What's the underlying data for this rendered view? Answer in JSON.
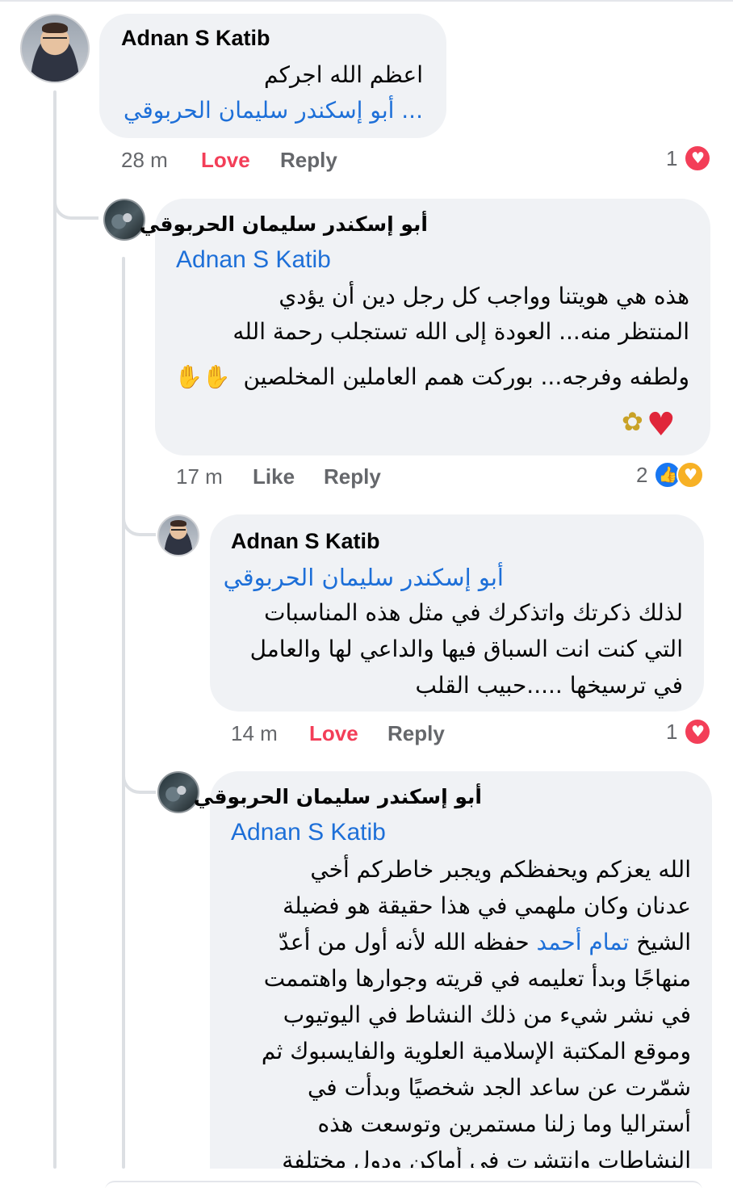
{
  "comments": [
    {
      "author": "Adnan S Katib",
      "line1": "اعظم الله اجركم",
      "line2_link": "... أبو إسكندر سليمان الحربوقي",
      "time": "28 m",
      "action": "Love",
      "reply": "Reply",
      "reaction_count": "1",
      "reactions": [
        "love"
      ]
    },
    {
      "author": "أبو إسكندر سليمان الحربوقي",
      "tag": "Adnan S Katib",
      "lines": [
        "هذه هي هويتنا وواجب كل رجل دين أن يؤدي",
        "المنتظر منه...  العودة إلى الله تستجلب رحمة الله",
        "ولطفه وفرجه... بوركت همم العاملين المخلصين"
      ],
      "inline_emoji": "hands-icon",
      "trailing_emojis": [
        "heart",
        "bouquet"
      ],
      "time": "17 m",
      "action": "Like",
      "reply": "Reply",
      "reaction_count": "2",
      "reactions": [
        "like",
        "care"
      ]
    },
    {
      "author": "Adnan S Katib",
      "tag_ar": "أبو إسكندر سليمان الحربوقي",
      "lines": [
        "لذلك ذكرتك واتذكرك في مثل هذه المناسبات",
        "التي كنت انت السباق فيها والداعي لها والعامل",
        "في ترسيخها .....حبيب القلب"
      ],
      "time": "14 m",
      "action": "Love",
      "reply": "Reply",
      "reaction_count": "1",
      "reactions": [
        "love"
      ]
    },
    {
      "author": "أبو إسكندر سليمان الحربوقي",
      "tag": "Adnan S Katib",
      "lines": [
        "الله يعزكم ويحفظكم ويجبر خاطركم أخي",
        "عدنان وكان ملهمي في هذا حقيقة هو فضيلة",
        "منهاجًا وبدأ تعليمه في قريته وجوارها واهتممت",
        "في نشر شيء من ذلك النشاط في اليوتيوب",
        "وموقع المكتبة الإسلامية العلوية والفايسبوك ثم",
        "شمّرت عن ساعد الجد شخصيًا وبدأت في",
        "أستراليا وما زلنا مستمرين وتوسعت هذه",
        "النشاطات وانتشرت في أماكن ودول مختلفة"
      ],
      "line3_prefix": "الشيخ ",
      "line3_mention": "تمام أحمد",
      "line3_suffix": " حفظه الله لأنه أول من أعدّ"
    }
  ],
  "colors": {
    "bubble": "#f0f2f5",
    "link": "#1d6fd8",
    "love": "#f33e58",
    "like": "#1877f2",
    "meta": "#65676b",
    "thread_line": "#dcdfe3"
  }
}
